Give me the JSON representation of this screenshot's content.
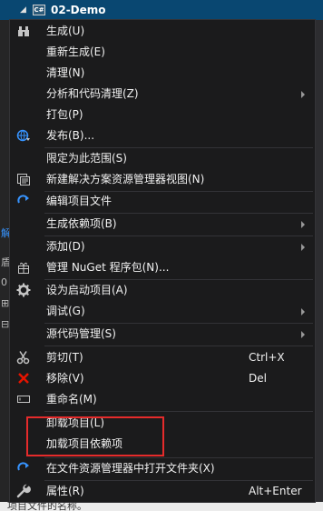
{
  "project": {
    "name": "02-Demo",
    "icon": "csharp-project-icon"
  },
  "side_fragments": [
    "解",
    "盾",
    "0",
    "⊞",
    "⊟"
  ],
  "status_text": "项目文件的名称。",
  "menu": {
    "items": [
      {
        "id": "build",
        "label": "生成(U)",
        "icon": "build-icon"
      },
      {
        "id": "rebuild",
        "label": "重新生成(E)"
      },
      {
        "id": "clean",
        "label": "清理(N)"
      },
      {
        "id": "analyze",
        "label": "分析和代码清理(Z)",
        "submenu": true
      },
      {
        "id": "pack",
        "label": "打包(P)"
      },
      {
        "id": "publish",
        "label": "发布(B)...",
        "icon": "globe-publish-icon"
      },
      {
        "id": "scope",
        "label": "限定为此范围(S)"
      },
      {
        "id": "new-view",
        "label": "新建解决方案资源管理器视图(N)",
        "icon": "solution-view-icon"
      },
      {
        "id": "edit-project",
        "label": "编辑项目文件",
        "icon": "refresh-arrow-icon"
      },
      {
        "id": "build-deps",
        "label": "生成依赖项(B)",
        "submenu": true
      },
      {
        "id": "add",
        "label": "添加(D)",
        "submenu": true
      },
      {
        "id": "nuget",
        "label": "管理 NuGet 程序包(N)...",
        "icon": "nuget-package-icon"
      },
      {
        "id": "startup",
        "label": "设为启动项目(A)",
        "icon": "gear-icon"
      },
      {
        "id": "debug",
        "label": "调试(G)",
        "submenu": true
      },
      {
        "id": "source-control",
        "label": "源代码管理(S)",
        "submenu": true
      },
      {
        "id": "cut",
        "label": "剪切(T)",
        "shortcut": "Ctrl+X",
        "icon": "scissors-icon"
      },
      {
        "id": "remove",
        "label": "移除(V)",
        "shortcut": "Del",
        "icon": "red-x-icon"
      },
      {
        "id": "rename",
        "label": "重命名(M)",
        "icon": "rename-icon"
      },
      {
        "id": "unload",
        "label": "卸载项目(L)"
      },
      {
        "id": "load-deps",
        "label": "加载项目依赖项"
      },
      {
        "id": "open-folder",
        "label": "在文件资源管理器中打开文件夹(X)",
        "icon": "refresh-arrow-icon"
      },
      {
        "id": "properties",
        "label": "属性(R)",
        "shortcut": "Alt+Enter",
        "icon": "wrench-icon"
      }
    ]
  },
  "colors": {
    "menu_bg": "#1b1b1c",
    "text": "#f1f1f1",
    "selection": "#094771",
    "highlight_box": "#e52b2b",
    "separator": "#333337"
  }
}
